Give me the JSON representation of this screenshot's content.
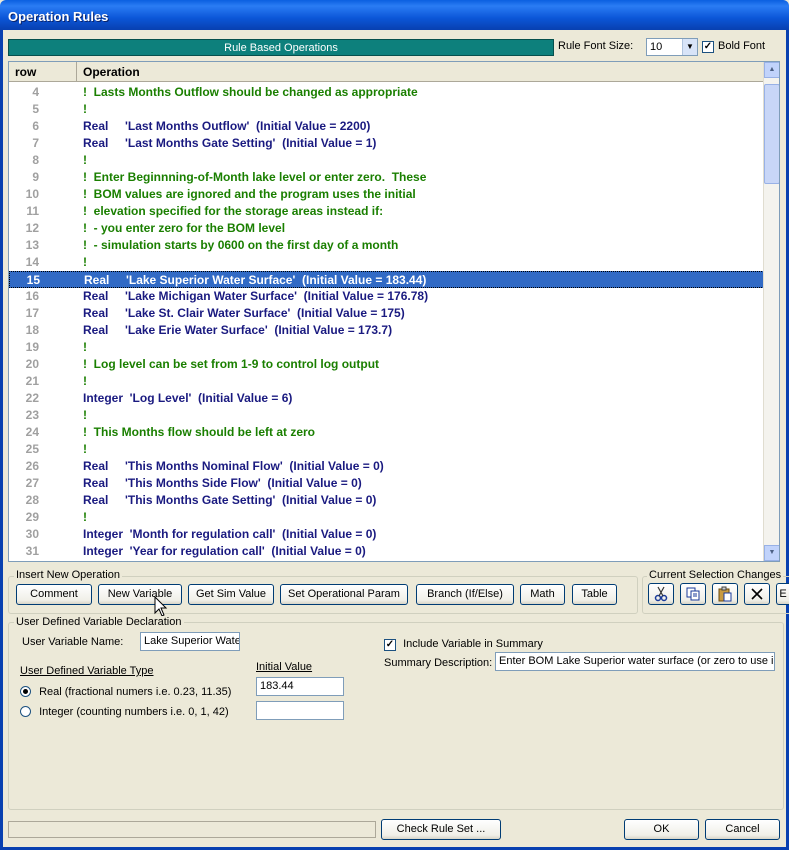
{
  "window": {
    "title": "Operation Rules"
  },
  "toolbar": {
    "banner": "Rule Based Operations",
    "font_size_label": "Rule Font Size:",
    "font_size_value": "10",
    "bold_font_label": "Bold Font",
    "bold_font_checked": true
  },
  "grid": {
    "columns": [
      "row",
      "Operation"
    ],
    "rows": [
      {
        "num": "4",
        "kind": "comment",
        "text": "!  Lasts Months Outflow should be changed as appropriate"
      },
      {
        "num": "5",
        "kind": "comment",
        "text": "!"
      },
      {
        "num": "6",
        "kind": "code",
        "text": "Real     'Last Months Outflow'  (Initial Value = 2200)"
      },
      {
        "num": "7",
        "kind": "code",
        "text": "Real     'Last Months Gate Setting'  (Initial Value = 1)"
      },
      {
        "num": "8",
        "kind": "comment",
        "text": "!"
      },
      {
        "num": "9",
        "kind": "comment",
        "text": "!  Enter Beginnning-of-Month lake level or enter zero.  These"
      },
      {
        "num": "10",
        "kind": "comment",
        "text": "!  BOM values are ignored and the program uses the initial"
      },
      {
        "num": "11",
        "kind": "comment",
        "text": "!  elevation specified for the storage areas instead if:"
      },
      {
        "num": "12",
        "kind": "comment",
        "text": "!  - you enter zero for the BOM level"
      },
      {
        "num": "13",
        "kind": "comment",
        "text": "!  - simulation starts by 0600 on the first day of a month"
      },
      {
        "num": "14",
        "kind": "comment",
        "text": "!"
      },
      {
        "num": "15",
        "kind": "code",
        "selected": true,
        "text": "Real     'Lake Superior Water Surface'  (Initial Value = 183.44)"
      },
      {
        "num": "16",
        "kind": "code",
        "text": "Real     'Lake Michigan Water Surface'  (Initial Value = 176.78)"
      },
      {
        "num": "17",
        "kind": "code",
        "text": "Real     'Lake St. Clair Water Surface'  (Initial Value = 175)"
      },
      {
        "num": "18",
        "kind": "code",
        "text": "Real     'Lake Erie Water Surface'  (Initial Value = 173.7)"
      },
      {
        "num": "19",
        "kind": "comment",
        "text": "!"
      },
      {
        "num": "20",
        "kind": "comment",
        "text": "!  Log level can be set from 1-9 to control log output"
      },
      {
        "num": "21",
        "kind": "comment",
        "text": "!"
      },
      {
        "num": "22",
        "kind": "code",
        "text": "Integer  'Log Level'  (Initial Value = 6)"
      },
      {
        "num": "23",
        "kind": "comment",
        "text": "!"
      },
      {
        "num": "24",
        "kind": "comment",
        "text": "!  This Months flow should be left at zero"
      },
      {
        "num": "25",
        "kind": "comment",
        "text": "!"
      },
      {
        "num": "26",
        "kind": "code",
        "text": "Real     'This Months Nominal Flow'  (Initial Value = 0)"
      },
      {
        "num": "27",
        "kind": "code",
        "text": "Real     'This Months Side Flow'  (Initial Value = 0)"
      },
      {
        "num": "28",
        "kind": "code",
        "text": "Real     'This Months Gate Setting'  (Initial Value = 0)"
      },
      {
        "num": "29",
        "kind": "comment",
        "text": "!"
      },
      {
        "num": "30",
        "kind": "code",
        "text": "Integer  'Month for regulation call'  (Initial Value = 0)"
      },
      {
        "num": "31",
        "kind": "code",
        "text": "Integer  'Year for regulation call'  (Initial Value = 0)"
      }
    ]
  },
  "insert_group": {
    "label": "Insert New Operation",
    "buttons": {
      "comment": "Comment",
      "new_variable": "New Variable",
      "get_sim_value": "Get Sim Value",
      "set_param": "Set Operational Param",
      "branch": "Branch (If/Else)",
      "math": "Math",
      "table": "Table"
    }
  },
  "selection_group": {
    "label": "Current Selection Changes",
    "icons": [
      "cut-icon",
      "copy-icon",
      "paste-icon",
      "delete-icon"
    ],
    "overflow_label": "E"
  },
  "var_group": {
    "label": "User Defined Variable Declaration",
    "name_label": "User Variable Name:",
    "name_value": "Lake Superior Wate",
    "type_label": "User Defined Variable Type",
    "initial_label": "Initial Value",
    "real_label": "Real (fractional numers i.e. 0.23, 11.35)",
    "integer_label": "Integer (counting numbers i.e.  0, 1, 42)",
    "real_value": "183.44",
    "integer_value": "",
    "include_label": "Include Variable in Summary",
    "include_checked": true,
    "summary_label": "Summary Description:",
    "summary_value": "Enter BOM Lake Superior water surface (or zero to use init"
  },
  "footer": {
    "check_label": "Check Rule Set ...",
    "ok_label": "OK",
    "cancel_label": "Cancel"
  }
}
